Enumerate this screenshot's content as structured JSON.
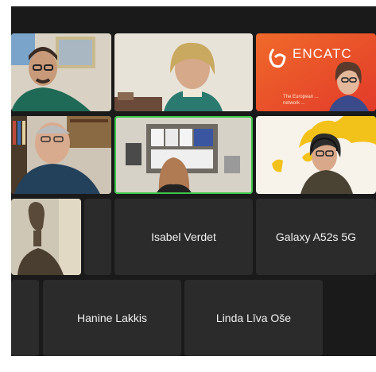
{
  "meeting": {
    "participants": [
      {
        "name": "Isabel Verdet",
        "video": false
      },
      {
        "name": "Galaxy A52s 5G",
        "video": false
      },
      {
        "name": "Hanine Lakkis",
        "video": false
      },
      {
        "name": "Linda Līva Oše",
        "video": false
      }
    ],
    "shared_slide": {
      "brand_text": "ENCATC",
      "subtitle_text": "The European ... network ..."
    },
    "colors": {
      "background": "#1a1a1a",
      "tile": "#2b2b2b",
      "active_speaker_border": "#3cc84a",
      "label": "#f2f2f2",
      "slide_orange": "#f05a28"
    }
  }
}
